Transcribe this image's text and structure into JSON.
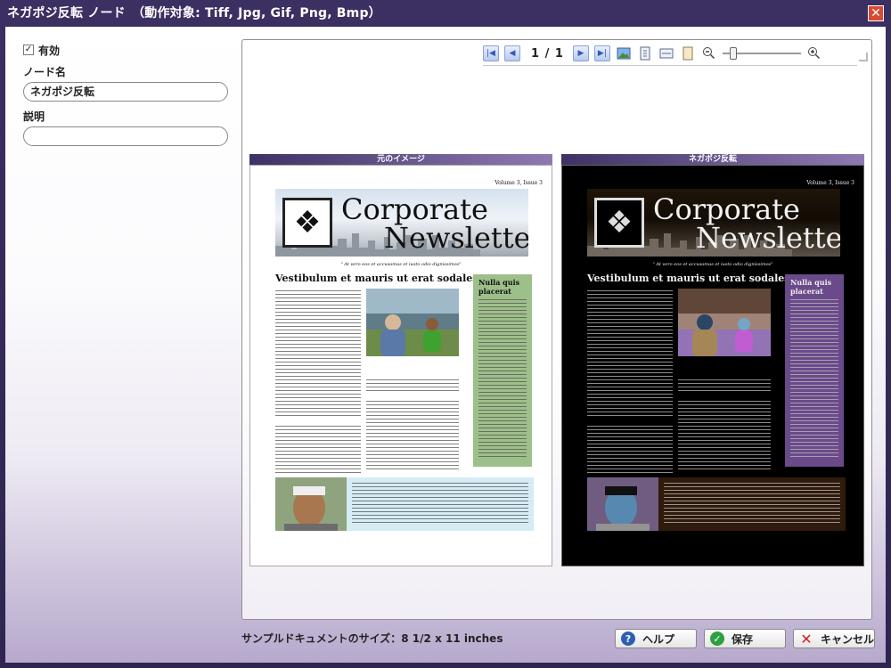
{
  "window": {
    "title": "ネガポジ反転 ノード　（動作対象: Tiff, Jpg, Gif, Png, Bmp）",
    "close_symbol": "✕"
  },
  "form": {
    "enabled_label": "有効",
    "enabled_checked": true,
    "node_name_label": "ノード名",
    "node_name_value": "ネガポジ反転",
    "description_label": "説明",
    "description_value": ""
  },
  "toolbar": {
    "page_current": "1",
    "page_separator": "/",
    "page_total": "1",
    "icons": [
      "first-page-icon",
      "prev-page-icon",
      "next-page-icon",
      "last-page-icon",
      "image-icon",
      "fit-page-icon",
      "fit-width-icon",
      "actual-size-icon",
      "zoom-out-icon",
      "zoom-in-icon"
    ],
    "zoom_level": 0.1
  },
  "panes": {
    "original_header": "元のイメージ",
    "negative_header": "ネガポジ反転"
  },
  "newsletter": {
    "volume": "Volume 3, Issue 3",
    "title_line1": "Corporate",
    "title_line2": "Newsletter",
    "tagline": "\" At vero eos et accusamus et iusto odio dignissimos\"",
    "headline": "Vestibulum et mauris ut erat sodales",
    "sidebar_heading_line1": "Nulla quis",
    "sidebar_heading_line2": "placerat"
  },
  "status": {
    "sample_size_text": "サンプルドキュメントのサイズ：8 1/2 x 11 inches"
  },
  "buttons": {
    "help_label": "ヘルプ",
    "save_label": "保存",
    "cancel_label": "キャンセル"
  },
  "colors": {
    "title_bar": "#3c2f62",
    "pane_header": "#5a4a86",
    "sidebar_original": "#9dbf8a",
    "sidebar_negative": "#6a4a8a",
    "callout_original": "#d5ecf5",
    "cancel_icon": "#d81e1e",
    "save_icon": "#2ea043",
    "help_icon": "#2e5fb0"
  }
}
